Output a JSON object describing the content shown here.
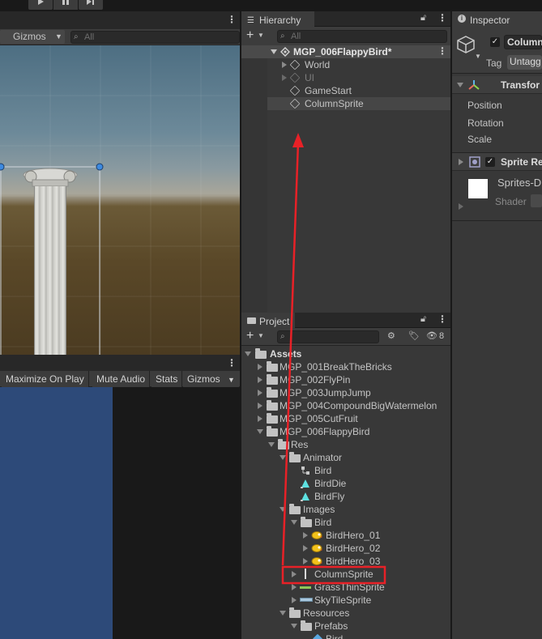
{
  "colors": {
    "panel": "#383838",
    "highlight_arrow": "#e82127",
    "selection": "#4a4a4a"
  },
  "scene": {
    "gizmos_label": "Gizmos",
    "search_placeholder": "All"
  },
  "game": {
    "maximize_label": "Maximize On Play",
    "mute_label": "Mute Audio",
    "stats_label": "Stats",
    "gizmos_label": "Gizmos"
  },
  "hierarchy": {
    "tab_label": "Hierarchy",
    "search_placeholder": "All",
    "scene_name": "MGP_006FlappyBird*",
    "items": [
      {
        "label": "World"
      },
      {
        "label": "UI"
      },
      {
        "label": "GameStart"
      },
      {
        "label": "ColumnSprite"
      }
    ]
  },
  "inspector": {
    "tab_label": "Inspector",
    "object_name": "Column",
    "tag_label": "Tag",
    "tag_value": "Untagg",
    "transform_label": "Transfor",
    "position_label": "Position",
    "rotation_label": "Rotation",
    "scale_label": "Scale",
    "sprite_renderer_label": "Sprite Re",
    "material_label": "Sprites-D",
    "shader_label": "Shader"
  },
  "project": {
    "tab_label": "Project",
    "hidden_count": "8",
    "tree": [
      {
        "label": "Assets",
        "bold": true
      },
      {
        "label": "MGP_001BreakTheBricks"
      },
      {
        "label": "MGP_002FlyPin"
      },
      {
        "label": "MGP_003JumpJump"
      },
      {
        "label": "MGP_004CompoundBigWatermelon"
      },
      {
        "label": "MGP_005CutFruit"
      },
      {
        "label": "MGP_006FlappyBird"
      },
      {
        "label": "Res"
      },
      {
        "label": "Animator"
      },
      {
        "label": "Bird"
      },
      {
        "label": "BirdDie"
      },
      {
        "label": "BirdFly"
      },
      {
        "label": "Images"
      },
      {
        "label": "Bird"
      },
      {
        "label": "BirdHero_01"
      },
      {
        "label": "BirdHero_02"
      },
      {
        "label": "BirdHero_03"
      },
      {
        "label": "ColumnSprite"
      },
      {
        "label": "GrassThinSprite"
      },
      {
        "label": "SkyTileSprite"
      },
      {
        "label": "Resources"
      },
      {
        "label": "Prefabs"
      },
      {
        "label": "Bird"
      }
    ]
  }
}
